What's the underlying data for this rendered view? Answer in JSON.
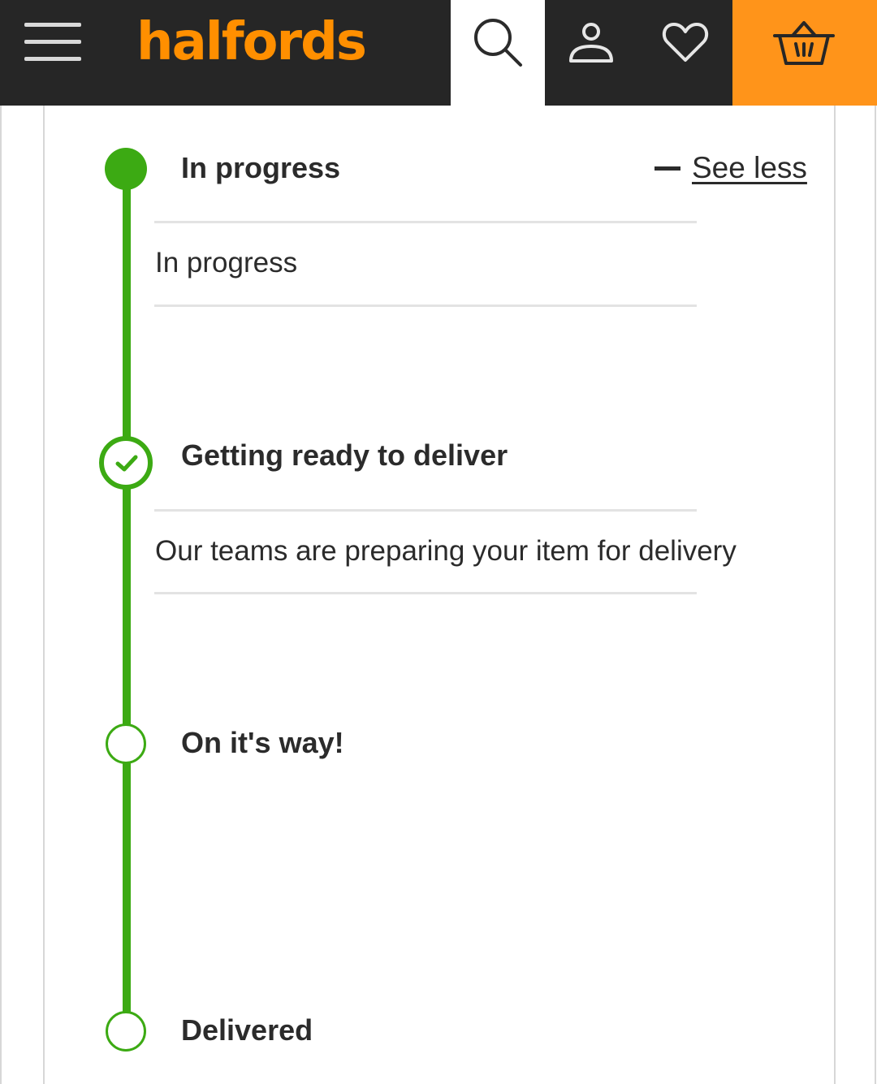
{
  "header": {
    "brand": "halfords",
    "icons": {
      "menu": "hamburger-menu-icon",
      "search": "search-icon",
      "account": "account-icon",
      "wishlist": "heart-icon",
      "basket": "basket-icon"
    },
    "colors": {
      "bar": "#262626",
      "brand": "#ff8f00",
      "basket_bg": "#ff941a"
    }
  },
  "tracker": {
    "toggle_label": "See less",
    "accent": "#3caa13",
    "steps": [
      {
        "title": "In progress",
        "description": "In progress",
        "state": "current"
      },
      {
        "title": "Getting ready to deliver",
        "description": "Our teams are preparing your item for delivery",
        "state": "complete"
      },
      {
        "title": "On it's way!",
        "state": "pending"
      },
      {
        "title": "Delivered",
        "state": "pending"
      }
    ]
  }
}
